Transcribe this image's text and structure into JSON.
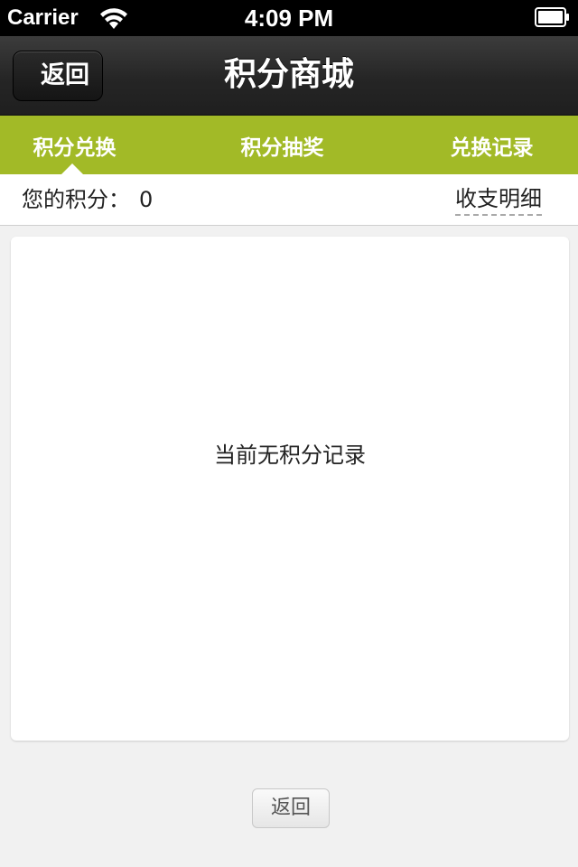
{
  "status_bar": {
    "carrier": "Carrier",
    "time": "4:09 PM",
    "wifi_icon": "wifi-icon",
    "battery_icon": "battery-icon"
  },
  "nav_bar": {
    "back_label": "返回",
    "title": "积分商城"
  },
  "tabs": [
    {
      "label": "积分兑换",
      "active": true
    },
    {
      "label": "积分抽奖",
      "active": false
    },
    {
      "label": "兑换记录",
      "active": false
    }
  ],
  "points": {
    "label": "您的积分：",
    "value": "0",
    "details_link": "收支明细"
  },
  "content": {
    "empty_message": "当前无积分记录"
  },
  "footer": {
    "back_label": "返回"
  },
  "colors": {
    "tab_bar": "#a2ba27",
    "nav_bar": "#252525"
  }
}
